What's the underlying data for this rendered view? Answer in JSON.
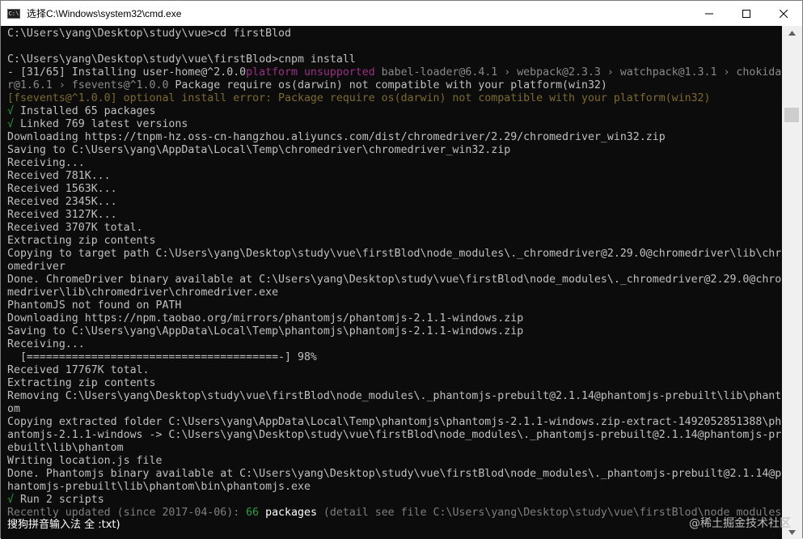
{
  "window": {
    "title": "选择C:\\Windows\\system32\\cmd.exe",
    "icon_text": "C:\\",
    "controls": [
      "minimize-icon",
      "maximize-icon",
      "close-icon"
    ]
  },
  "console": {
    "lines": [
      {
        "segments": [
          {
            "text": "C:\\Users\\yang\\Desktop\\study\\vue>cd firstBlod"
          }
        ]
      },
      {
        "segments": [
          {
            "text": ""
          }
        ]
      },
      {
        "segments": [
          {
            "text": "C:\\Users\\yang\\Desktop\\study\\vue\\firstBlod>cnpm install"
          }
        ]
      },
      {
        "segments": [
          {
            "text": "- [31/65] Installing user-home@^2.0.0"
          },
          {
            "text": "platform unsupported",
            "cls": "pink"
          },
          {
            "text": " babel-loader@6.4.1 › webpack@2.3.3 › watchpack@1.3.1 › chokida",
            "cls": "muted"
          }
        ]
      },
      {
        "segments": [
          {
            "text": "r@1.6.1 › fsevents@^1.0.0",
            "cls": "muted"
          },
          {
            "text": " Package require os(darwin) not compatible with your platform(win32)"
          }
        ]
      },
      {
        "segments": [
          {
            "text": "[fsevents@^1.0.0] optional install error: Package require os(darwin) not compatible with your platform(win32)",
            "cls": "warn"
          }
        ]
      },
      {
        "segments": [
          {
            "text": "√",
            "cls": "green"
          },
          {
            "text": " Installed 65 packages"
          }
        ]
      },
      {
        "segments": [
          {
            "text": "√",
            "cls": "green"
          },
          {
            "text": " Linked 769 latest versions"
          }
        ]
      },
      {
        "segments": [
          {
            "text": "Downloading https://tnpm-hz.oss-cn-hangzhou.aliyuncs.com/dist/chromedriver/2.29/chromedriver_win32.zip"
          }
        ]
      },
      {
        "segments": [
          {
            "text": "Saving to C:\\Users\\yang\\AppData\\Local\\Temp\\chromedriver\\chromedriver_win32.zip"
          }
        ]
      },
      {
        "segments": [
          {
            "text": "Receiving..."
          }
        ]
      },
      {
        "segments": [
          {
            "text": "Received 781K..."
          }
        ]
      },
      {
        "segments": [
          {
            "text": "Received 1563K..."
          }
        ]
      },
      {
        "segments": [
          {
            "text": "Received 2345K..."
          }
        ]
      },
      {
        "segments": [
          {
            "text": "Received 3127K..."
          }
        ]
      },
      {
        "segments": [
          {
            "text": "Received 3707K total."
          }
        ]
      },
      {
        "segments": [
          {
            "text": "Extracting zip contents"
          }
        ]
      },
      {
        "segments": [
          {
            "text": "Copying to target path C:\\Users\\yang\\Desktop\\study\\vue\\firstBlod\\node_modules\\._chromedriver@2.29.0@chromedriver\\lib\\chr"
          }
        ]
      },
      {
        "segments": [
          {
            "text": "omedriver"
          }
        ]
      },
      {
        "segments": [
          {
            "text": "Done. ChromeDriver binary available at C:\\Users\\yang\\Desktop\\study\\vue\\firstBlod\\node_modules\\._chromedriver@2.29.0@chro"
          }
        ]
      },
      {
        "segments": [
          {
            "text": "medriver\\lib\\chromedriver\\chromedriver.exe"
          }
        ]
      },
      {
        "segments": [
          {
            "text": "PhantomJS not found on PATH"
          }
        ]
      },
      {
        "segments": [
          {
            "text": "Downloading https://npm.taobao.org/mirrors/phantomjs/phantomjs-2.1.1-windows.zip"
          }
        ]
      },
      {
        "segments": [
          {
            "text": "Saving to C:\\Users\\yang\\AppData\\Local\\Temp\\phantomjs\\phantomjs-2.1.1-windows.zip"
          }
        ]
      },
      {
        "segments": [
          {
            "text": "Receiving..."
          }
        ]
      },
      {
        "segments": [
          {
            "text": "  [=======================================-] 98%"
          }
        ]
      },
      {
        "segments": [
          {
            "text": "Received 17767K total."
          }
        ]
      },
      {
        "segments": [
          {
            "text": "Extracting zip contents"
          }
        ]
      },
      {
        "segments": [
          {
            "text": "Removing C:\\Users\\yang\\Desktop\\study\\vue\\firstBlod\\node_modules\\._phantomjs-prebuilt@2.1.14@phantomjs-prebuilt\\lib\\phant"
          }
        ]
      },
      {
        "segments": [
          {
            "text": "om"
          }
        ]
      },
      {
        "segments": [
          {
            "text": "Copying extracted folder C:\\Users\\yang\\AppData\\Local\\Temp\\phantomjs\\phantomjs-2.1.1-windows.zip-extract-1492052851388\\ph"
          }
        ]
      },
      {
        "segments": [
          {
            "text": "antomjs-2.1.1-windows -> C:\\Users\\yang\\Desktop\\study\\vue\\firstBlod\\node_modules\\._phantomjs-prebuilt@2.1.14@phantomjs-pr"
          }
        ]
      },
      {
        "segments": [
          {
            "text": "ebuilt\\lib\\phantom"
          }
        ]
      },
      {
        "segments": [
          {
            "text": "Writing location.js file"
          }
        ]
      },
      {
        "segments": [
          {
            "text": "Done. Phantomjs binary available at C:\\Users\\yang\\Desktop\\study\\vue\\firstBlod\\node_modules\\._phantomjs-prebuilt@2.1.14@p"
          }
        ]
      },
      {
        "segments": [
          {
            "text": "hantomjs-prebuilt\\lib\\phantom\\bin\\phantomjs.exe"
          }
        ]
      },
      {
        "segments": [
          {
            "text": "√",
            "cls": "green"
          },
          {
            "text": " Run 2 scripts"
          }
        ]
      },
      {
        "segments": [
          {
            "text": "Recently updated (since 2017-04-06): ",
            "cls": "dimline"
          },
          {
            "text": "66",
            "cls": "green"
          },
          {
            "text": " packages ",
            "cls": "white"
          },
          {
            "text": "(detail see file C:\\Users\\yang\\Desktop\\study\\vue\\firstBlod\\node_modules",
            "cls": "dimline"
          }
        ]
      }
    ]
  },
  "ime": {
    "text": "搜狗拼音输入法 全 :txt)"
  },
  "watermark": {
    "text": "@稀土掘金技术社区"
  },
  "colors": {
    "console_bg": "#0c0c0c",
    "console_text": "#c0c0c0",
    "unsupported": "#9b2f86",
    "success": "#2ea043",
    "warning": "#7d6a2f"
  }
}
